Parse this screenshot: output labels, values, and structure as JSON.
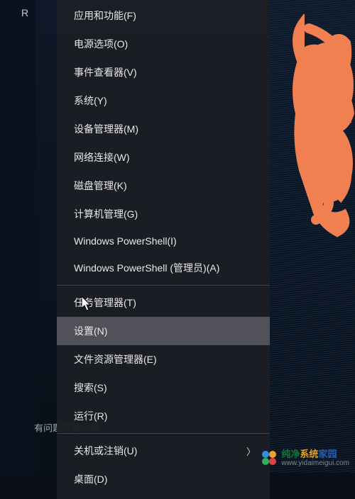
{
  "taskbar": {
    "icon_letter": "R",
    "search_hint": "有问题尽管问我"
  },
  "menu": {
    "groups": [
      {
        "items": [
          {
            "id": "apps-features",
            "label": "应用和功能(F)",
            "submenu": false
          },
          {
            "id": "power-options",
            "label": "电源选项(O)",
            "submenu": false
          },
          {
            "id": "event-viewer",
            "label": "事件查看器(V)",
            "submenu": false
          },
          {
            "id": "system",
            "label": "系统(Y)",
            "submenu": false
          },
          {
            "id": "device-manager",
            "label": "设备管理器(M)",
            "submenu": false
          },
          {
            "id": "network-connections",
            "label": "网络连接(W)",
            "submenu": false
          },
          {
            "id": "disk-management",
            "label": "磁盘管理(K)",
            "submenu": false
          },
          {
            "id": "computer-management",
            "label": "计算机管理(G)",
            "submenu": false
          },
          {
            "id": "powershell",
            "label": "Windows PowerShell(I)",
            "submenu": false
          },
          {
            "id": "powershell-admin",
            "label": "Windows PowerShell (管理员)(A)",
            "submenu": false
          }
        ]
      },
      {
        "items": [
          {
            "id": "task-manager",
            "label": "任务管理器(T)",
            "submenu": false
          },
          {
            "id": "settings",
            "label": "设置(N)",
            "submenu": false,
            "hover": true
          },
          {
            "id": "file-explorer",
            "label": "文件资源管理器(E)",
            "submenu": false
          },
          {
            "id": "search",
            "label": "搜索(S)",
            "submenu": false
          },
          {
            "id": "run",
            "label": "运行(R)",
            "submenu": false
          }
        ]
      },
      {
        "items": [
          {
            "id": "shutdown-signout",
            "label": "关机或注销(U)",
            "submenu": true
          },
          {
            "id": "desktop",
            "label": "桌面(D)",
            "submenu": false
          }
        ]
      }
    ]
  },
  "watermark": {
    "brand_parts": [
      "纯净",
      "系统",
      "家园"
    ],
    "url": "www.yidaimeigui.com"
  },
  "annotation": {
    "scribble_color": "#f08050"
  }
}
